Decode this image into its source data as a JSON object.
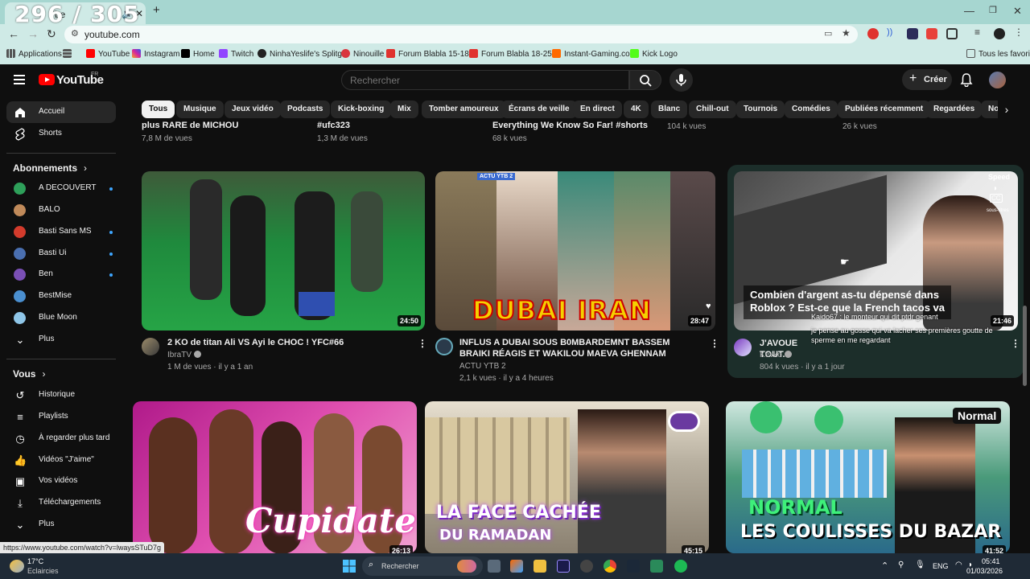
{
  "browser": {
    "tab_counter": "296 / 305",
    "tab_title": "be",
    "url": "youtube.com",
    "new_tab_symbol": "+",
    "bookmarks": [
      "Applications",
      "YouTube",
      "Instagram",
      "Home",
      "Twitch",
      "NinhaYeslife's Splitg...",
      "Ninouille",
      "Forum Blabla 15-18...",
      "Forum Blabla 18-25...",
      "Instant-Gaming.com",
      "Kick Logo"
    ],
    "other_bookmarks": "Tous les favoris"
  },
  "header": {
    "logo_text": "YouTube",
    "country": "FR",
    "search_placeholder": "Rechercher",
    "create_label": "Créer"
  },
  "chips": [
    "Tous",
    "Musique",
    "Jeux vidéo",
    "Podcasts",
    "Kick-boxing",
    "Mix",
    "Tomber amoureux",
    "Écrans de veille",
    "En direct",
    "4K",
    "Blanc",
    "Chill-out",
    "Tournois",
    "Comédies",
    "Publiées récemment",
    "Regardées",
    "No"
  ],
  "sidebar": {
    "main": [
      {
        "label": "Accueil",
        "icon": "home-icon"
      },
      {
        "label": "Shorts",
        "icon": "shorts-icon"
      }
    ],
    "subscriptions_title": "Abonnements",
    "subscriptions": [
      {
        "label": "A DECOUVERT",
        "color": "#2ea05a",
        "live": true
      },
      {
        "label": "BALO",
        "color": "#c08a5a",
        "live": false
      },
      {
        "label": "Basti Sans MS",
        "color": "#d33b2c",
        "live": true
      },
      {
        "label": "Basti Ui",
        "color": "#4a6fb0",
        "live": true
      },
      {
        "label": "Ben",
        "color": "#7a4fb5",
        "live": true
      },
      {
        "label": "BestMise",
        "color": "#4a8fd0",
        "live": false
      },
      {
        "label": "Blue Moon",
        "color": "#8fc6e8",
        "live": false
      }
    ],
    "more_label": "Plus",
    "you_title": "Vous",
    "you_items": [
      {
        "label": "Historique",
        "icon": "history-icon"
      },
      {
        "label": "Playlists",
        "icon": "playlists-icon"
      },
      {
        "label": "À regarder plus tard",
        "icon": "watch-later-icon"
      },
      {
        "label": "Vidéos \"J'aime\"",
        "icon": "like-icon"
      },
      {
        "label": "Vos vidéos",
        "icon": "your-videos-icon"
      },
      {
        "label": "Téléchargements",
        "icon": "download-icon"
      },
      {
        "label": "Plus",
        "icon": "chevron-down-icon"
      }
    ]
  },
  "top_row": [
    {
      "title": "plus RARE de MICHOU",
      "views": "7,8 M de vues"
    },
    {
      "title": "#ufc323",
      "views": "1,3 M de vues"
    },
    {
      "title": "Everything We Know So Far! #shorts",
      "views": "68 k vues"
    },
    {
      "title": "",
      "views": "104 k vues"
    },
    {
      "title": "",
      "views": "26 k vues"
    }
  ],
  "videos_row1": [
    {
      "title": "2 KO de titan Ali VS Ayi le CHOC ! YFC#66",
      "channel": "IbraTV",
      "stats": "1 M de vues · il y a 1 an",
      "duration": "24:50"
    },
    {
      "title": "INFLUS A DUBAI SOUS B0MBARDEMNT BASSEM BRAIKI RÉAGIS ET WAKILOU MAEVA GHENNAM BLATA MILLA ...",
      "channel": "ACTU YTB 2",
      "stats": "2,1 k vues · il y a 4 heures",
      "duration": "28:47",
      "thumb_text": "DUBAI IRAN",
      "badge": "ACTU YTB 2"
    },
    {
      "title": "J'AVOUE TOUT...",
      "channel": "Kevko",
      "stats": "804 k vues · il y a 1 jour",
      "duration": "21:46",
      "thumb_text": "Combien d'argent as-tu dépensé dans Roblox ? Est-ce que la French tacos va",
      "chat1": "Kaido67 : le monteur qui dit ptdr genant",
      "chat2": "je pense au gosse qui va lacher ses premières goutte de sperme en me regardant",
      "speed_label": "Speed",
      "cc_label": "sous-titres"
    }
  ],
  "videos_row2": [
    {
      "duration": "26:13",
      "thumb_text": "Cupidate"
    },
    {
      "duration": "45:15",
      "thumb_text1": "LA FACE CACHÉE",
      "thumb_text2": "DU RAMADAN"
    },
    {
      "duration": "41:52",
      "thumb_text1": "NORMAL",
      "thumb_text2": "LES COULISSES DU BAZAR",
      "badge": "Normal"
    }
  ],
  "status_url": "https://www.youtube.com/watch?v=lwaysSTuD7g",
  "taskbar": {
    "weather_temp": "17°C",
    "weather_desc": "Eclaircies",
    "search_label": "Rechercher",
    "lang": "ENG",
    "time": "05:41",
    "date": "01/03/2026"
  }
}
